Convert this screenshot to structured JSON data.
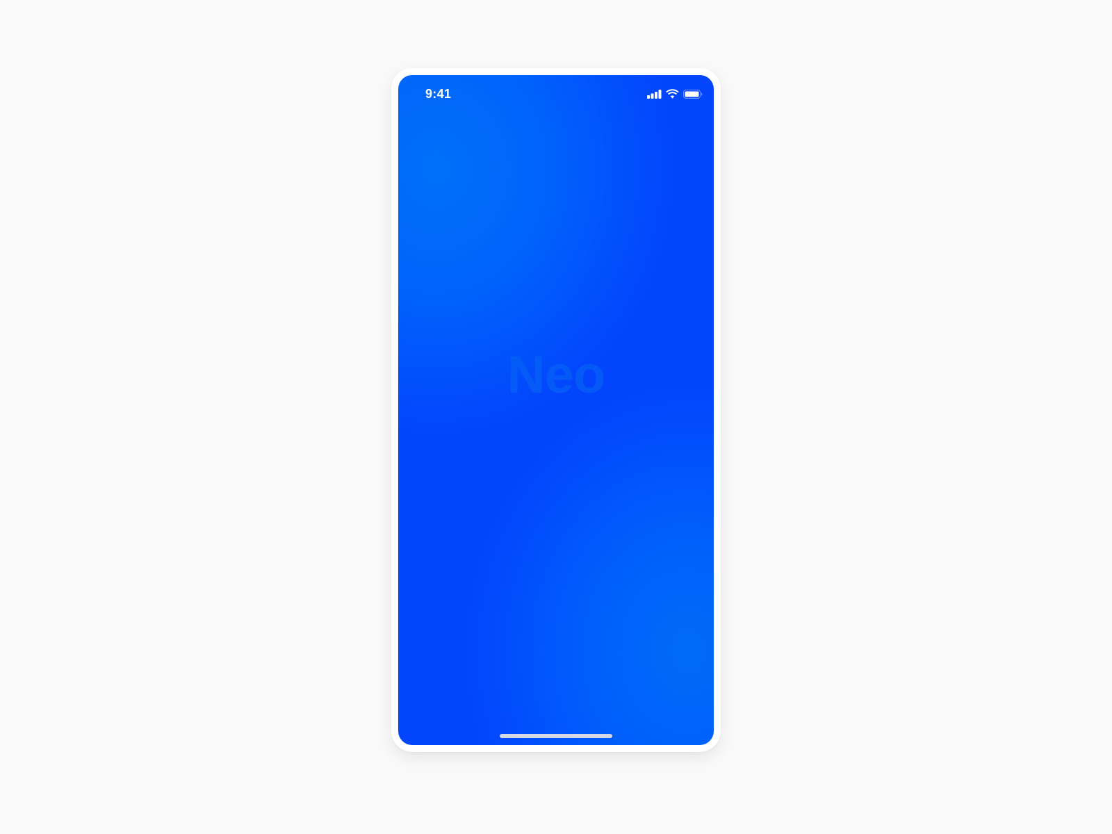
{
  "status_bar": {
    "time": "9:41",
    "icons": [
      "cellular-signal-icon",
      "wifi-icon",
      "battery-icon"
    ]
  },
  "splash": {
    "logo_text": "Neo"
  },
  "colors": {
    "page_background": "#f9f9f9",
    "device_frame": "#ffffff",
    "screen_base": "#0245fd",
    "screen_glow": "#006ff9",
    "logo_text": "#0661f5",
    "status_text": "#ffffff",
    "home_indicator": "#d5d9e4"
  }
}
